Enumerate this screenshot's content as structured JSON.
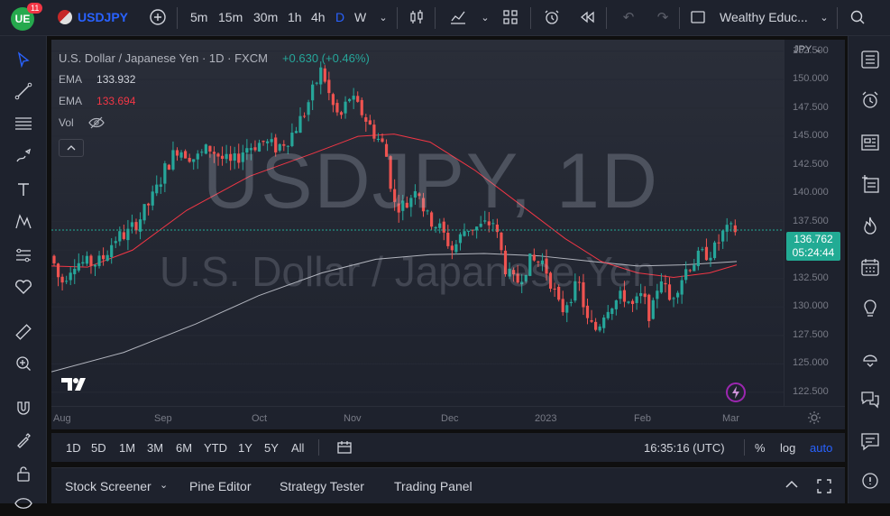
{
  "topbar": {
    "logo": "UE",
    "notification_count": "11",
    "symbol": "USDJPY",
    "timeframes": [
      "5m",
      "15m",
      "30m",
      "1h",
      "4h",
      "D",
      "W"
    ],
    "active_timeframe": "D",
    "layout_name": "Wealthy Educ..."
  },
  "chart": {
    "header_title": "U.S. Dollar / Japanese Yen · 1D · FXCM",
    "change": "+0.630 (+0.46%)",
    "ema1_label": "EMA",
    "ema1_value": "133.932",
    "ema2_label": "EMA",
    "ema2_value": "133.694",
    "vol_label": "Vol",
    "watermark_symbol": "USDJPY, 1D",
    "watermark_name": "U.S. Dollar / Japanese Yen",
    "currency": "JPY",
    "last_price": "136.762",
    "countdown": "05:24:44",
    "colors": {
      "up": "#26a69a",
      "down": "#ef5350",
      "ema_fast": "#f23645",
      "ema_slow": "#b2b5be",
      "price_tag": "#22ab94"
    }
  },
  "price_axis": [
    "152.500",
    "150.000",
    "147.500",
    "145.000",
    "142.500",
    "140.000",
    "137.500",
    "135.000",
    "132.500",
    "130.000",
    "127.500",
    "125.000",
    "122.500"
  ],
  "time_axis": [
    "Aug",
    "Sep",
    "Oct",
    "Nov",
    "Dec",
    "2023",
    "Feb",
    "Mar"
  ],
  "bottom_toolbar": {
    "ranges": [
      "1D",
      "5D",
      "1M",
      "3M",
      "6M",
      "YTD",
      "1Y",
      "5Y",
      "All"
    ],
    "time": "16:35:16 (UTC)",
    "percent": "%",
    "log": "log",
    "auto": "auto"
  },
  "panels": {
    "stock_screener": "Stock Screener",
    "pine_editor": "Pine Editor",
    "strategy_tester": "Strategy Tester",
    "trading_panel": "Trading Panel"
  }
}
